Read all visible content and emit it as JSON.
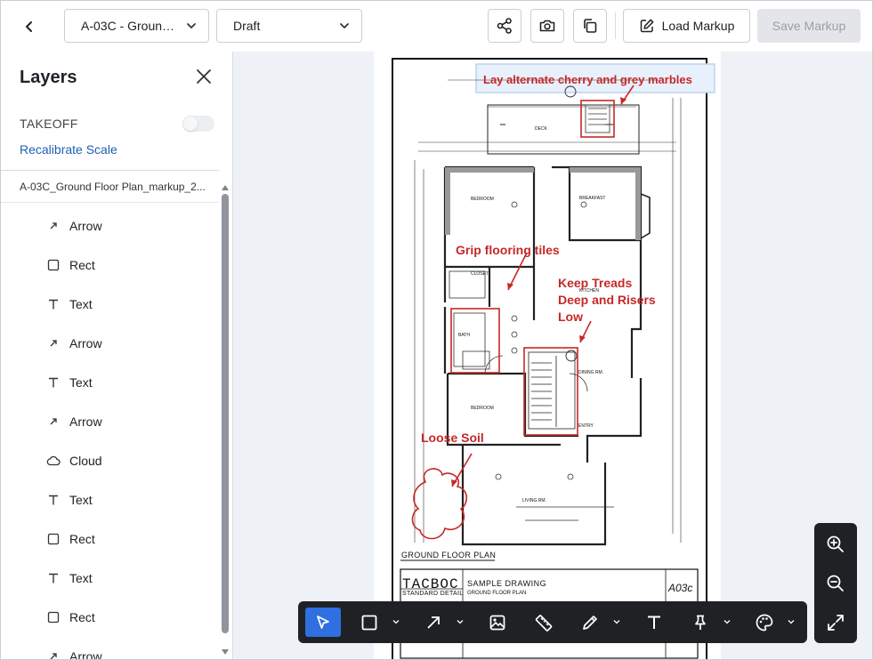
{
  "header": {
    "document_select": "A-03C - Groun…",
    "status_select": "Draft",
    "load_markup": "Load Markup",
    "save_markup": "Save Markup"
  },
  "panel": {
    "title": "Layers",
    "takeoff_label": "TAKEOFF",
    "takeoff_enabled": false,
    "recalibrate": "Recalibrate Scale",
    "file_name": "A-03C_Ground Floor Plan_markup_2...",
    "layers": [
      {
        "icon": "arrow-icon",
        "label": "Arrow"
      },
      {
        "icon": "rect-icon",
        "label": "Rect"
      },
      {
        "icon": "text-icon",
        "label": "Text"
      },
      {
        "icon": "arrow-icon",
        "label": "Arrow"
      },
      {
        "icon": "text-icon",
        "label": "Text"
      },
      {
        "icon": "arrow-icon",
        "label": "Arrow"
      },
      {
        "icon": "cloud-icon",
        "label": "Cloud"
      },
      {
        "icon": "text-icon",
        "label": "Text"
      },
      {
        "icon": "rect-icon",
        "label": "Rect"
      },
      {
        "icon": "text-icon",
        "label": "Text"
      },
      {
        "icon": "rect-icon",
        "label": "Rect"
      },
      {
        "icon": "arrow-icon",
        "label": "Arrow"
      }
    ]
  },
  "drawing": {
    "markups": {
      "top_note": "Lay alternate cherry and grey marbles",
      "grip_note": "Grip flooring tiles",
      "keep_note_lines": [
        "Keep Treads",
        "Deep and Risers",
        "Low"
      ],
      "loose_note": "Loose Soil"
    },
    "plan_title": "GROUND FLOOR PLAN",
    "title_block": {
      "company": "TACBOC",
      "company_sub": "STANDARD DETAIL",
      "sheet_title": "SAMPLE DRAWING",
      "sheet_sub": "GROUND FLOOR PLAN",
      "sheet_no": "A03c"
    },
    "rooms": [
      "DECK",
      "BEDROOM",
      "BREAKFAST",
      "CLOSET",
      "KITCHEN",
      "BATH",
      "DINING RM.",
      "BEDROOM",
      "ENTRY",
      "LIVING RM."
    ]
  },
  "toolbar": {
    "tools": [
      "select-tool",
      "rect-tool",
      "arrow-tool",
      "image-tool",
      "measure-tool",
      "pen-tool",
      "text-tool",
      "pin-tool",
      "color-tool"
    ],
    "active_tool": "select-tool"
  },
  "colors": {
    "markup_red": "#c62828",
    "accent_blue": "#2f6fe0",
    "toolbar_bg": "#202124"
  }
}
